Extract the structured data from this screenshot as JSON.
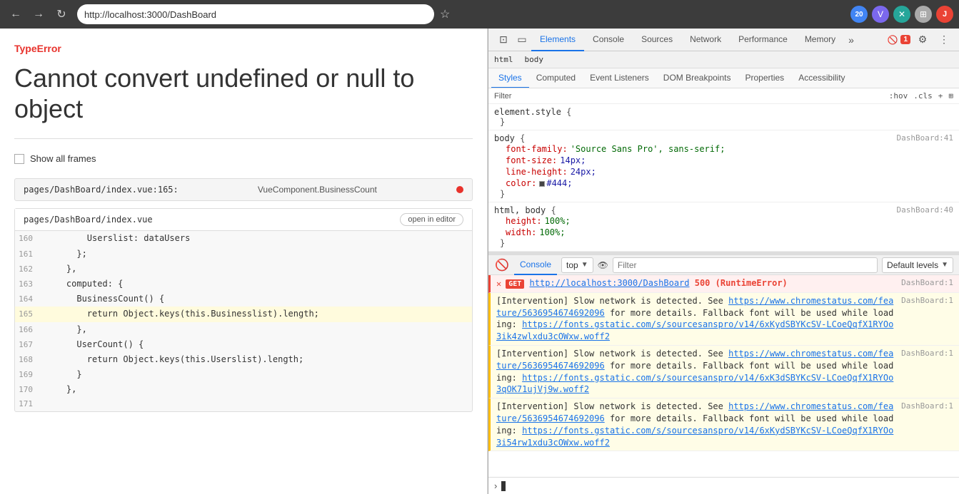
{
  "browser": {
    "back_label": "←",
    "forward_label": "→",
    "reload_label": "↻",
    "url": "http://localhost:3000/DashBoard",
    "star_icon": "☆",
    "icons": [
      {
        "id": "numbered",
        "label": "20",
        "color": "#4285f4"
      },
      {
        "id": "v",
        "label": "V",
        "color": "#7b68ee"
      },
      {
        "id": "x",
        "label": "✕",
        "color": "#26a69a"
      },
      {
        "id": "puzzle",
        "label": "⊞",
        "color": "#aaa"
      },
      {
        "id": "j",
        "label": "J",
        "color": "#ea4335"
      }
    ]
  },
  "page": {
    "error_type": "TypeError",
    "error_message": "Cannot convert undefined or\nnull to object",
    "show_all_frames_label": "Show all frames",
    "frames": [
      {
        "file": "pages/DashBoard/index.vue:165:",
        "component": "VueComponent.BusinessCount",
        "has_error": true
      }
    ],
    "code_file": "pages/DashBoard/index.vue",
    "open_in_editor": "open in editor",
    "code_lines": [
      {
        "num": "160",
        "content": "        Userslist: dataUsers",
        "highlight": false
      },
      {
        "num": "161",
        "content": "      };",
        "highlight": false
      },
      {
        "num": "162",
        "content": "    },",
        "highlight": false
      },
      {
        "num": "163",
        "content": "    computed: {",
        "highlight": false
      },
      {
        "num": "164",
        "content": "      BusinessCount() {",
        "highlight": false
      },
      {
        "num": "165",
        "content": "        return Object.keys(this.Businesslist).length;",
        "highlight": true
      },
      {
        "num": "166",
        "content": "      },",
        "highlight": false
      },
      {
        "num": "167",
        "content": "      UserCount() {",
        "highlight": false
      },
      {
        "num": "168",
        "content": "        return Object.keys(this.Userslist).length;",
        "highlight": false
      },
      {
        "num": "169",
        "content": "      }",
        "highlight": false
      },
      {
        "num": "170",
        "content": "    },",
        "highlight": false
      },
      {
        "num": "171",
        "content": "",
        "highlight": false
      }
    ]
  },
  "devtools": {
    "tabs": [
      {
        "id": "elements",
        "label": "Elements",
        "active": true
      },
      {
        "id": "console",
        "label": "Console",
        "active": false
      },
      {
        "id": "sources",
        "label": "Sources",
        "active": false
      },
      {
        "id": "network",
        "label": "Network",
        "active": false
      },
      {
        "id": "performance",
        "label": "Performance",
        "active": false
      },
      {
        "id": "memory",
        "label": "Memory",
        "active": false
      }
    ],
    "more_tabs": "»",
    "error_badge": "1",
    "breadcrumb": [
      "html",
      "body"
    ],
    "subtabs": [
      {
        "id": "styles",
        "label": "Styles",
        "active": true
      },
      {
        "id": "computed",
        "label": "Computed",
        "active": false
      },
      {
        "id": "event-listeners",
        "label": "Event Listeners",
        "active": false
      },
      {
        "id": "dom-breakpoints",
        "label": "DOM Breakpoints",
        "active": false
      },
      {
        "id": "properties",
        "label": "Properties",
        "active": false
      },
      {
        "id": "accessibility",
        "label": "Accessibility",
        "active": false
      }
    ],
    "styles": {
      "filter_placeholder": "Filter",
      "hov_label": ":hov",
      "cls_label": ".cls",
      "add_icon": "+",
      "blocks": [
        {
          "selector": "element.style",
          "brace_open": " {",
          "brace_close": "}",
          "source": "",
          "props": []
        },
        {
          "selector": "body",
          "brace_open": " {",
          "brace_close": "}",
          "source": "DashBoard:41",
          "props": [
            {
              "name": "font-family:",
              "value": "'Source Sans Pro', sans-serif;",
              "is_string": true
            },
            {
              "name": "font-size:",
              "value": "14px;"
            },
            {
              "name": "line-height:",
              "value": "24px;"
            },
            {
              "name": "color:",
              "value": "#444;",
              "has_swatch": true,
              "swatch_color": "#444"
            }
          ]
        },
        {
          "selector": "html, body",
          "brace_open": " {",
          "brace_close": "}",
          "source": "DashBoard:40",
          "props": [
            {
              "name": "height:",
              "value": "100%;"
            },
            {
              "name": "width:",
              "value": "100%;"
            }
          ]
        }
      ]
    },
    "console": {
      "tab_label": "Console",
      "context": "top",
      "filter_placeholder": "Filter",
      "level": "Default levels",
      "messages": [
        {
          "type": "error",
          "method": "GET",
          "url": "http://localhost:3000/DashBoard",
          "status": "500 (RuntimeError)",
          "source": "DashBoard:1"
        },
        {
          "type": "warning",
          "text": "[Intervention] Slow network is detected. See ",
          "link": "https://www.chromestatus.com/feature/5636954674692096",
          "link_suffix": " for more details. Fallback font will be used while loading: ",
          "link2": "https://fonts.gstatic.com/s/sourcesanspro/v14/6xKydSBYKcSV-LCoeQqfX1RYOo3ik4zwlxdu3cOWxw.woff2",
          "source": "DashBoard:1"
        },
        {
          "type": "warning",
          "text": "[Intervention] Slow network is detected. See ",
          "link": "https://www.chromestatus.com/feature/5636954674692096",
          "link_suffix": " for more details. Fallback font will be used while loading: ",
          "link2": "https://fonts.gstatic.com/s/sourcesanspro/v14/6xK3dSBYKcSV-LCoeQqfX1RYOo3qOK71ujVj9w.woff2",
          "source": "DashBoard:1"
        },
        {
          "type": "warning",
          "text": "[Intervention] Slow network is detected. See ",
          "link": "https://www.chromestatus.com/feature/5636954674692096",
          "link_suffix": " for more details. Fallback font will be used while loading: ",
          "link2": "https://fonts.gstatic.com/s/sourcesanspro/v14/6xKydSBYKcSV-LCoeQqfX1RYOo3i54rw1xdu3cOWxw.woff2",
          "source": "DashBoard:1"
        }
      ]
    }
  }
}
